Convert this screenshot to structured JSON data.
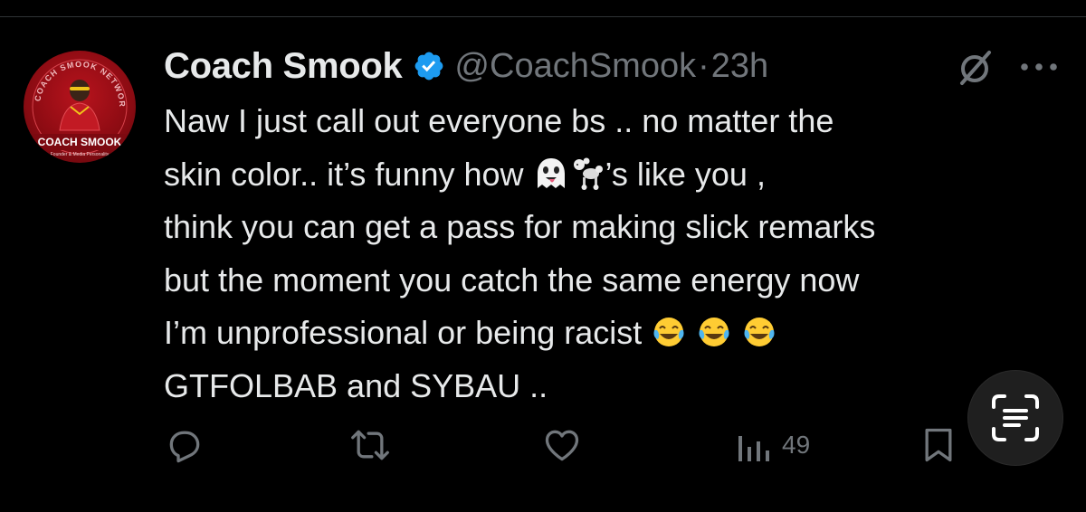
{
  "author": {
    "display_name": "Coach Smook",
    "handle": "@CoachSmook",
    "separator": "·",
    "timestamp": "23h",
    "verified": true,
    "avatar": {
      "ring_text": "COACH SMOOK NETWORK",
      "name_text": "COACH SMOOK",
      "subtitle_text": "Founder & Media Personality"
    }
  },
  "tweet": {
    "lines": [
      "Naw I just call out everyone bs .. no matter the",
      "skin color.. it’s  funny how ",
      "’s  like you ,",
      "think  you can get a pass for  making slick remarks",
      "but the moment you catch the same energy now",
      "I’m unprofessional or being racist ",
      "GTFOLBAB and SYBAU .."
    ]
  },
  "actions": {
    "views_count": "49"
  },
  "icons": {
    "verified": "verified-badge-icon",
    "grok": "grok-icon",
    "more": "more-options-icon",
    "reply": "reply-icon",
    "retweet": "retweet-icon",
    "like": "like-icon",
    "views": "views-chart-icon",
    "bookmark": "bookmark-icon",
    "scan": "text-scan-icon",
    "emoji_ghost": "ghost-emoji",
    "emoji_poodle": "poodle-emoji",
    "emoji_laughing": "tears-of-joy-emoji"
  },
  "colors": {
    "background": "#000000",
    "text_primary": "#e7e9ea",
    "text_secondary": "#71767b",
    "verified_blue": "#1d9bf0",
    "avatar_red": "#b8131d",
    "divider": "#2f3336"
  }
}
